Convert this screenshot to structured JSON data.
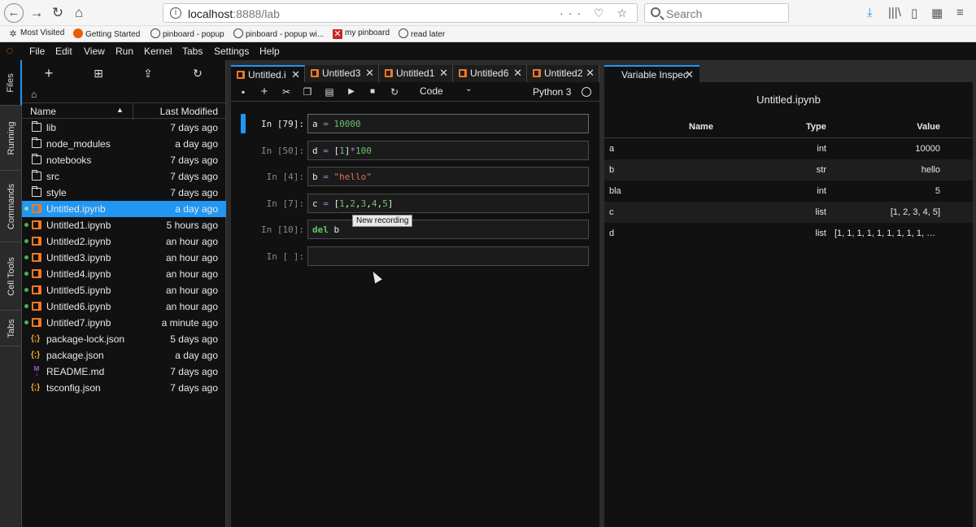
{
  "browser": {
    "url_host": "localhost",
    "url_path": ":8888/lab",
    "url_actions": "··· ♡ ☆",
    "search_placeholder": "Search",
    "bookmarks": [
      {
        "label": "Most Visited",
        "icon": "gear-icon"
      },
      {
        "label": "Getting Started",
        "icon": "firefox-icon"
      },
      {
        "label": "pinboard - popup",
        "icon": "globe-icon"
      },
      {
        "label": "pinboard - popup wi...",
        "icon": "globe-icon"
      },
      {
        "label": "my pinboard",
        "icon": "pin-icon"
      },
      {
        "label": "read later",
        "icon": "globe-icon"
      }
    ]
  },
  "menubar": {
    "items": [
      "File",
      "Edit",
      "View",
      "Run",
      "Kernel",
      "Tabs",
      "Settings",
      "Help"
    ]
  },
  "side_tabs": [
    "Files",
    "Running",
    "Commands",
    "Cell Tools",
    "Tabs"
  ],
  "file_browser": {
    "columns": {
      "name": "Name",
      "modified": "Last Modified"
    },
    "files": [
      {
        "name": "lib",
        "modified": "7 days ago",
        "type": "folder",
        "running": false,
        "selected": false
      },
      {
        "name": "node_modules",
        "modified": "a day ago",
        "type": "folder",
        "running": false,
        "selected": false
      },
      {
        "name": "notebooks",
        "modified": "7 days ago",
        "type": "folder",
        "running": false,
        "selected": false
      },
      {
        "name": "src",
        "modified": "7 days ago",
        "type": "folder",
        "running": false,
        "selected": false
      },
      {
        "name": "style",
        "modified": "7 days ago",
        "type": "folder",
        "running": false,
        "selected": false
      },
      {
        "name": "Untitled.ipynb",
        "modified": "a day ago",
        "type": "notebook",
        "running": true,
        "selected": true
      },
      {
        "name": "Untitled1.ipynb",
        "modified": "5 hours ago",
        "type": "notebook",
        "running": true,
        "selected": false
      },
      {
        "name": "Untitled2.ipynb",
        "modified": "an hour ago",
        "type": "notebook",
        "running": true,
        "selected": false
      },
      {
        "name": "Untitled3.ipynb",
        "modified": "an hour ago",
        "type": "notebook",
        "running": true,
        "selected": false
      },
      {
        "name": "Untitled4.ipynb",
        "modified": "an hour ago",
        "type": "notebook",
        "running": true,
        "selected": false
      },
      {
        "name": "Untitled5.ipynb",
        "modified": "an hour ago",
        "type": "notebook",
        "running": true,
        "selected": false
      },
      {
        "name": "Untitled6.ipynb",
        "modified": "an hour ago",
        "type": "notebook",
        "running": true,
        "selected": false
      },
      {
        "name": "Untitled7.ipynb",
        "modified": "a minute ago",
        "type": "notebook",
        "running": true,
        "selected": false
      },
      {
        "name": "package-lock.json",
        "modified": "5 days ago",
        "type": "json",
        "running": false,
        "selected": false
      },
      {
        "name": "package.json",
        "modified": "a day ago",
        "type": "json",
        "running": false,
        "selected": false
      },
      {
        "name": "README.md",
        "modified": "7 days ago",
        "type": "markdown",
        "running": false,
        "selected": false
      },
      {
        "name": "tsconfig.json",
        "modified": "7 days ago",
        "type": "json",
        "running": false,
        "selected": false
      }
    ]
  },
  "notebook": {
    "tabs": [
      {
        "label": "Untitled.i",
        "active": true
      },
      {
        "label": "Untitled3",
        "active": false
      },
      {
        "label": "Untitled1",
        "active": false
      },
      {
        "label": "Untitled6",
        "active": false
      },
      {
        "label": "Untitled2",
        "active": false
      }
    ],
    "cell_type": "Code",
    "kernel": "Python 3",
    "cells": [
      {
        "prompt": "In [79]:",
        "active": true,
        "tokens": [
          [
            "a "
          ],
          [
            "=",
            "op"
          ],
          [
            " "
          ],
          [
            "10000",
            "num"
          ]
        ]
      },
      {
        "prompt": "In [50]:",
        "active": false,
        "tokens": [
          [
            "d "
          ],
          [
            "=",
            "op"
          ],
          [
            " ["
          ],
          [
            "1",
            "num"
          ],
          [
            "]"
          ],
          [
            "*",
            "op"
          ],
          [
            "100",
            "num"
          ]
        ]
      },
      {
        "prompt": "In [4]:",
        "active": false,
        "tokens": [
          [
            "b "
          ],
          [
            "=",
            "op"
          ],
          [
            " "
          ],
          [
            "\"hello\"",
            "str"
          ]
        ]
      },
      {
        "prompt": "In [7]:",
        "active": false,
        "tokens": [
          [
            "c "
          ],
          [
            "=",
            "op"
          ],
          [
            " ["
          ],
          [
            "1",
            "num"
          ],
          [
            ","
          ],
          [
            "2",
            "num"
          ],
          [
            ","
          ],
          [
            "3",
            "num"
          ],
          [
            ","
          ],
          [
            "4",
            "num"
          ],
          [
            ","
          ],
          [
            "5",
            "num"
          ],
          [
            "]"
          ]
        ]
      },
      {
        "prompt": "In [10]:",
        "active": false,
        "tokens": [
          [
            "del",
            "kw"
          ],
          [
            " b"
          ]
        ]
      },
      {
        "prompt": "In [ ]:",
        "active": false,
        "tokens": []
      }
    ],
    "tooltip": "New recording"
  },
  "variable_inspector": {
    "tab_label": "Variable Inspec",
    "title": "Untitled.ipynb",
    "columns": {
      "name": "Name",
      "type": "Type",
      "value": "Value"
    },
    "rows": [
      {
        "name": "a",
        "type": "int",
        "value": "10000"
      },
      {
        "name": "b",
        "type": "str",
        "value": "hello"
      },
      {
        "name": "bla",
        "type": "int",
        "value": "5"
      },
      {
        "name": "c",
        "type": "list",
        "value": "[1, 2, 3, 4, 5]"
      },
      {
        "name": "d",
        "type": "list",
        "value": "[1, 1, 1, 1, 1, 1, 1, 1, 1, 1, ..."
      }
    ]
  }
}
